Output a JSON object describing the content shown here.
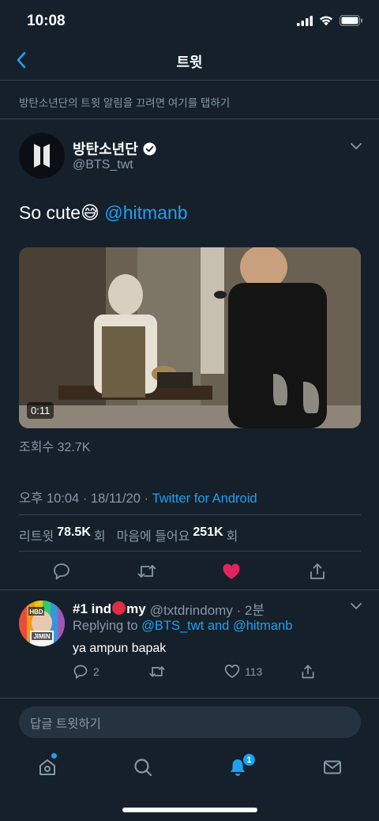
{
  "status_bar": {
    "time": "10:08"
  },
  "nav": {
    "title": "트윗"
  },
  "notification_banner": "방탄소년단의 트윗 알림을 끄려면 여기를 탭하기",
  "tweet": {
    "author_name": "방탄소년단",
    "author_handle": "@BTS_twt",
    "text": "So cute😅",
    "mention": "@hitmanb",
    "video_duration": "0:11",
    "views": "조회수 32.7K",
    "timestamp": "오후 10:04 · 18/11/20 · ",
    "source": "Twitter for Android",
    "retweets_label": "리트윗",
    "retweets_count": "78.5K",
    "retweets_suffix": "회",
    "likes_label": "마음에 들어요",
    "likes_count": "251K",
    "likes_suffix": "회",
    "liked": true
  },
  "reply": {
    "name_prefix": "#1 ind",
    "name_suffix": "my",
    "handle_time": "@txtdrindomy · 2분",
    "replying_prefix": "Replying to ",
    "replying_mention1": "@BTS_twt",
    "replying_and": " and ",
    "replying_mention2": "@hitmanb",
    "text": "ya ampun bapak",
    "reply_count": "2",
    "like_count": "113",
    "avatar_text_top": "HBD",
    "avatar_text_bottom": "JIMIN"
  },
  "compose": {
    "placeholder": "답글 트윗하기"
  },
  "tab_bar": {
    "notification_badge": "1"
  },
  "colors": {
    "background": "#15202b",
    "accent": "#1da1f2",
    "like": "#e0245e",
    "muted": "#8899a6"
  },
  "icons": [
    "back-icon",
    "verified-icon",
    "chevron-down-icon",
    "reply-icon",
    "retweet-icon",
    "heart-icon",
    "share-icon",
    "home-icon",
    "search-icon",
    "bell-icon",
    "mail-icon"
  ]
}
